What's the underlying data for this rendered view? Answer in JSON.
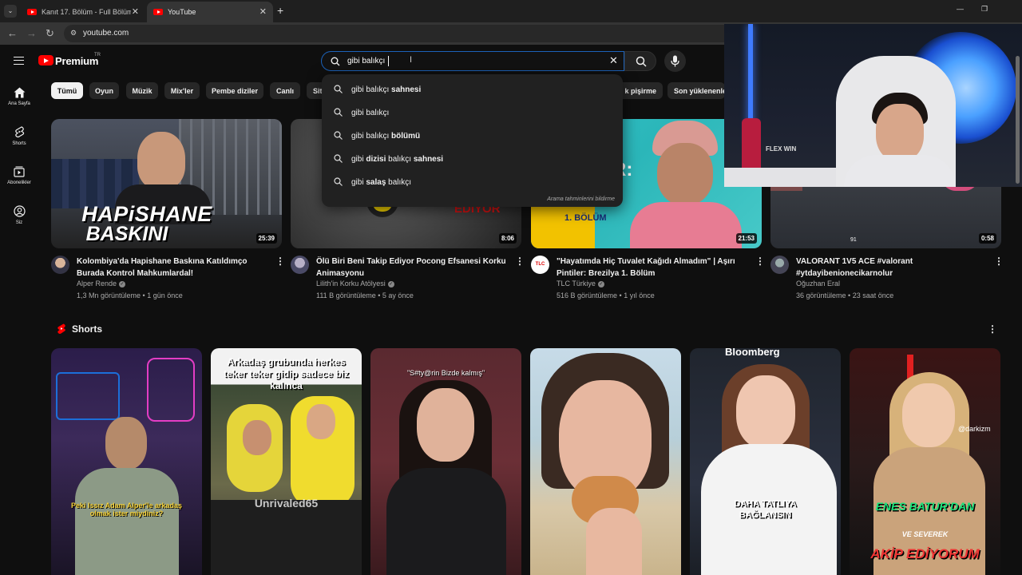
{
  "browser": {
    "tabs": [
      {
        "title": "Kanıt 17. Bölüm - Full Bölüm - Y",
        "active": false
      },
      {
        "title": "YouTube",
        "active": true
      }
    ],
    "new_tab": "+",
    "url": "youtube.com",
    "window": {
      "minimize": "—",
      "restore": "❐",
      "close": "✕"
    }
  },
  "header": {
    "logo_text": "Premium",
    "logo_region": "TR",
    "search_value": "gibi balıkçı"
  },
  "sidebar": [
    {
      "label": "Ana Sayfa",
      "icon": "home-icon"
    },
    {
      "label": "Shorts",
      "icon": "shorts-icon"
    },
    {
      "label": "Abonelikler",
      "icon": "subscriptions-icon"
    },
    {
      "label": "Siz",
      "icon": "you-icon"
    }
  ],
  "chips": [
    "Tümü",
    "Oyun",
    "Müzik",
    "Mix'ler",
    "Pembe diziler",
    "Canlı",
    "Sit",
    "k pişirme",
    "Son yüklenenler"
  ],
  "suggestions": {
    "items": [
      {
        "prefix": "gibi balıkçı ",
        "bold": "sahnesi",
        "text": "gibi balıkçı sahnesi"
      },
      {
        "prefix": "gibi balıkçı",
        "bold": "",
        "text": "gibi balıkçı"
      },
      {
        "prefix": "gibi balıkçı ",
        "bold": "bölümü",
        "text": "gibi balıkçı bölümü"
      },
      {
        "prefix": "gibi ",
        "bold": "dizisi",
        "text": "gibi dizisi balıkçı sahnesi"
      },
      {
        "prefix": "gibi ",
        "bold": "salaş",
        "text": "gibi salaş balıkçı"
      }
    ],
    "footer": "Arama tahminlerini bildirme"
  },
  "videos": [
    {
      "title": "Kolombiya'da Hapishane Baskına Katıldımço Burada Kontrol Mahkumlardal!",
      "channel": "Alper Rende",
      "verified": true,
      "meta": "1,3 Mn görüntüleme • 1 gün önce",
      "duration": "25:39",
      "thumb_text_1": "HAPiSHANE",
      "thumb_text_2": "BASKINI"
    },
    {
      "title": "Ölü Biri Beni Takip Ediyor Pocong Efsanesi Korku Animasyonu",
      "channel": "Lilith'in Korku Atölyesi",
      "verified": true,
      "meta": "111 B görüntüleme • 5 ay önce",
      "duration": "8:06",
      "thumb_text_1": "EDİYOR"
    },
    {
      "title": "\"Hayatımda Hiç Tuvalet Kağıdı Almadım\" | Aşırı Pintiler: Brezilya 1. Bölüm",
      "channel": "TLC Türkiye",
      "verified": true,
      "meta": "516 B görüntüleme • 1 yıl önce",
      "duration": "21:53",
      "thumb_text_1": "ER:",
      "thumb_text_2": "1. BÖLÜM",
      "avatar_text": "TLC"
    },
    {
      "title": "VALORANT 1V5 ACE #valorant #ytdayibenionecikarnolur",
      "channel": "Oğuzhan Eral",
      "verified": false,
      "meta": "36 görüntüleme • 23 saat önce",
      "duration": "0:58",
      "thumb_text_1": "91"
    }
  ],
  "shorts": {
    "title": "Shorts",
    "items": [
      {
        "caption": "Peki Issız Adam Alper'le arkadaş olmak ister miydiniz?"
      },
      {
        "caption": "Arkadaş grubunda herkes teker teker gidip sadece biz kalınca",
        "watermark": "Unrivaled65"
      },
      {
        "caption": "\"S#ty@rin Bizde kalmış\""
      },
      {
        "caption": ""
      },
      {
        "caption": "DAHA TATLIYA BAĞLANSIN",
        "brand": "Bloomberg"
      },
      {
        "caption": "ENES BATUR'DAN",
        "caption_2": "VE SEVEREK",
        "caption_3": "AKİP EDİYORUM",
        "handle": "@darkizm"
      }
    ]
  },
  "webcam": {
    "keyboard_label": "FLEX WIN"
  },
  "colors": {
    "background": "#0f0f0f",
    "brand_red": "#ff0000",
    "chip_bg": "#272727",
    "text_secondary": "#aaaaaa",
    "search_border": "#1c62b9"
  }
}
